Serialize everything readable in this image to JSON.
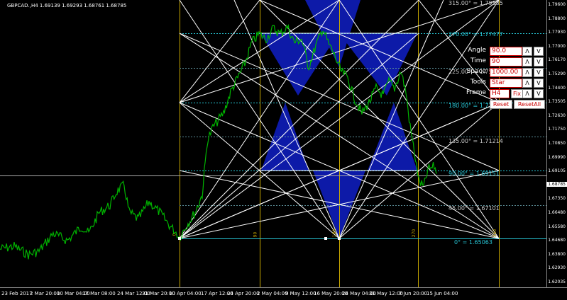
{
  "chart_title": "GBPCAD.,H4  1.69139 1.69293 1.68761 1.68785",
  "price_axis": [
    "1.79600",
    "1.78800",
    "1.77930",
    "1.77000",
    "1.76170",
    "1.75290",
    "1.74400",
    "1.73505",
    "1.72630",
    "1.71750",
    "1.70850",
    "1.69990",
    "1.69105",
    "1.68240",
    "1.67350",
    "1.66480",
    "1.65580",
    "1.64680",
    "1.63800",
    "1.62930",
    "1.62035"
  ],
  "current_price": "1.68785",
  "date_axis": [
    "23 Feb 2017",
    "2 Mar 20:00",
    "10 Mar 04:00",
    "17 Mar 08:00",
    "24 Mar 12:00",
    "31 Mar 20:00",
    "10 Apr 04:00",
    "17 Apr 12:00",
    "24 Apr 20:00",
    "2 May 04:00",
    "9 May 12:00",
    "16 May 20:00",
    "24 May 04:00",
    "31 May 12:00",
    "7 Jun 20:00",
    "15 Jun 04:00"
  ],
  "levels": {
    "l315": "315.00° = 1.79585",
    "l270": "270.00° = 1.77477",
    "l225": "225.00° = 1.75370",
    "l180": "180.00° = 1.73261",
    "l135": "135.00° = 1.71214",
    "l90": "90.00° = 1.69151",
    "l45": "45.00° = 1.67101",
    "l0": "0° = 1.65063"
  },
  "vert_labels": {
    "v0": "0",
    "v90": "90",
    "v180": "180",
    "v270": "270",
    "v360": "360"
  },
  "panel": {
    "angle_label": "Angle",
    "angle_value": "90.0",
    "time_label": "Time",
    "time_value": "90",
    "space_label": "Space",
    "space_value": "1000.00",
    "tools_label": "Tools",
    "tools_value": "Star",
    "frame_label": "Frame",
    "frame_value": "H4",
    "fix_label": "Fix",
    "up_label": "Λ",
    "down_label": "V",
    "reset_label": "Reset",
    "resetall_label": "ResetAll"
  },
  "colors": {
    "background": "#000000",
    "price_line": "#00b400",
    "time_lines": "#c8a800",
    "cyan_lines": "#27c6d6",
    "star_fill": "#0d1aa8",
    "fan_lines": "#ffffff"
  }
}
